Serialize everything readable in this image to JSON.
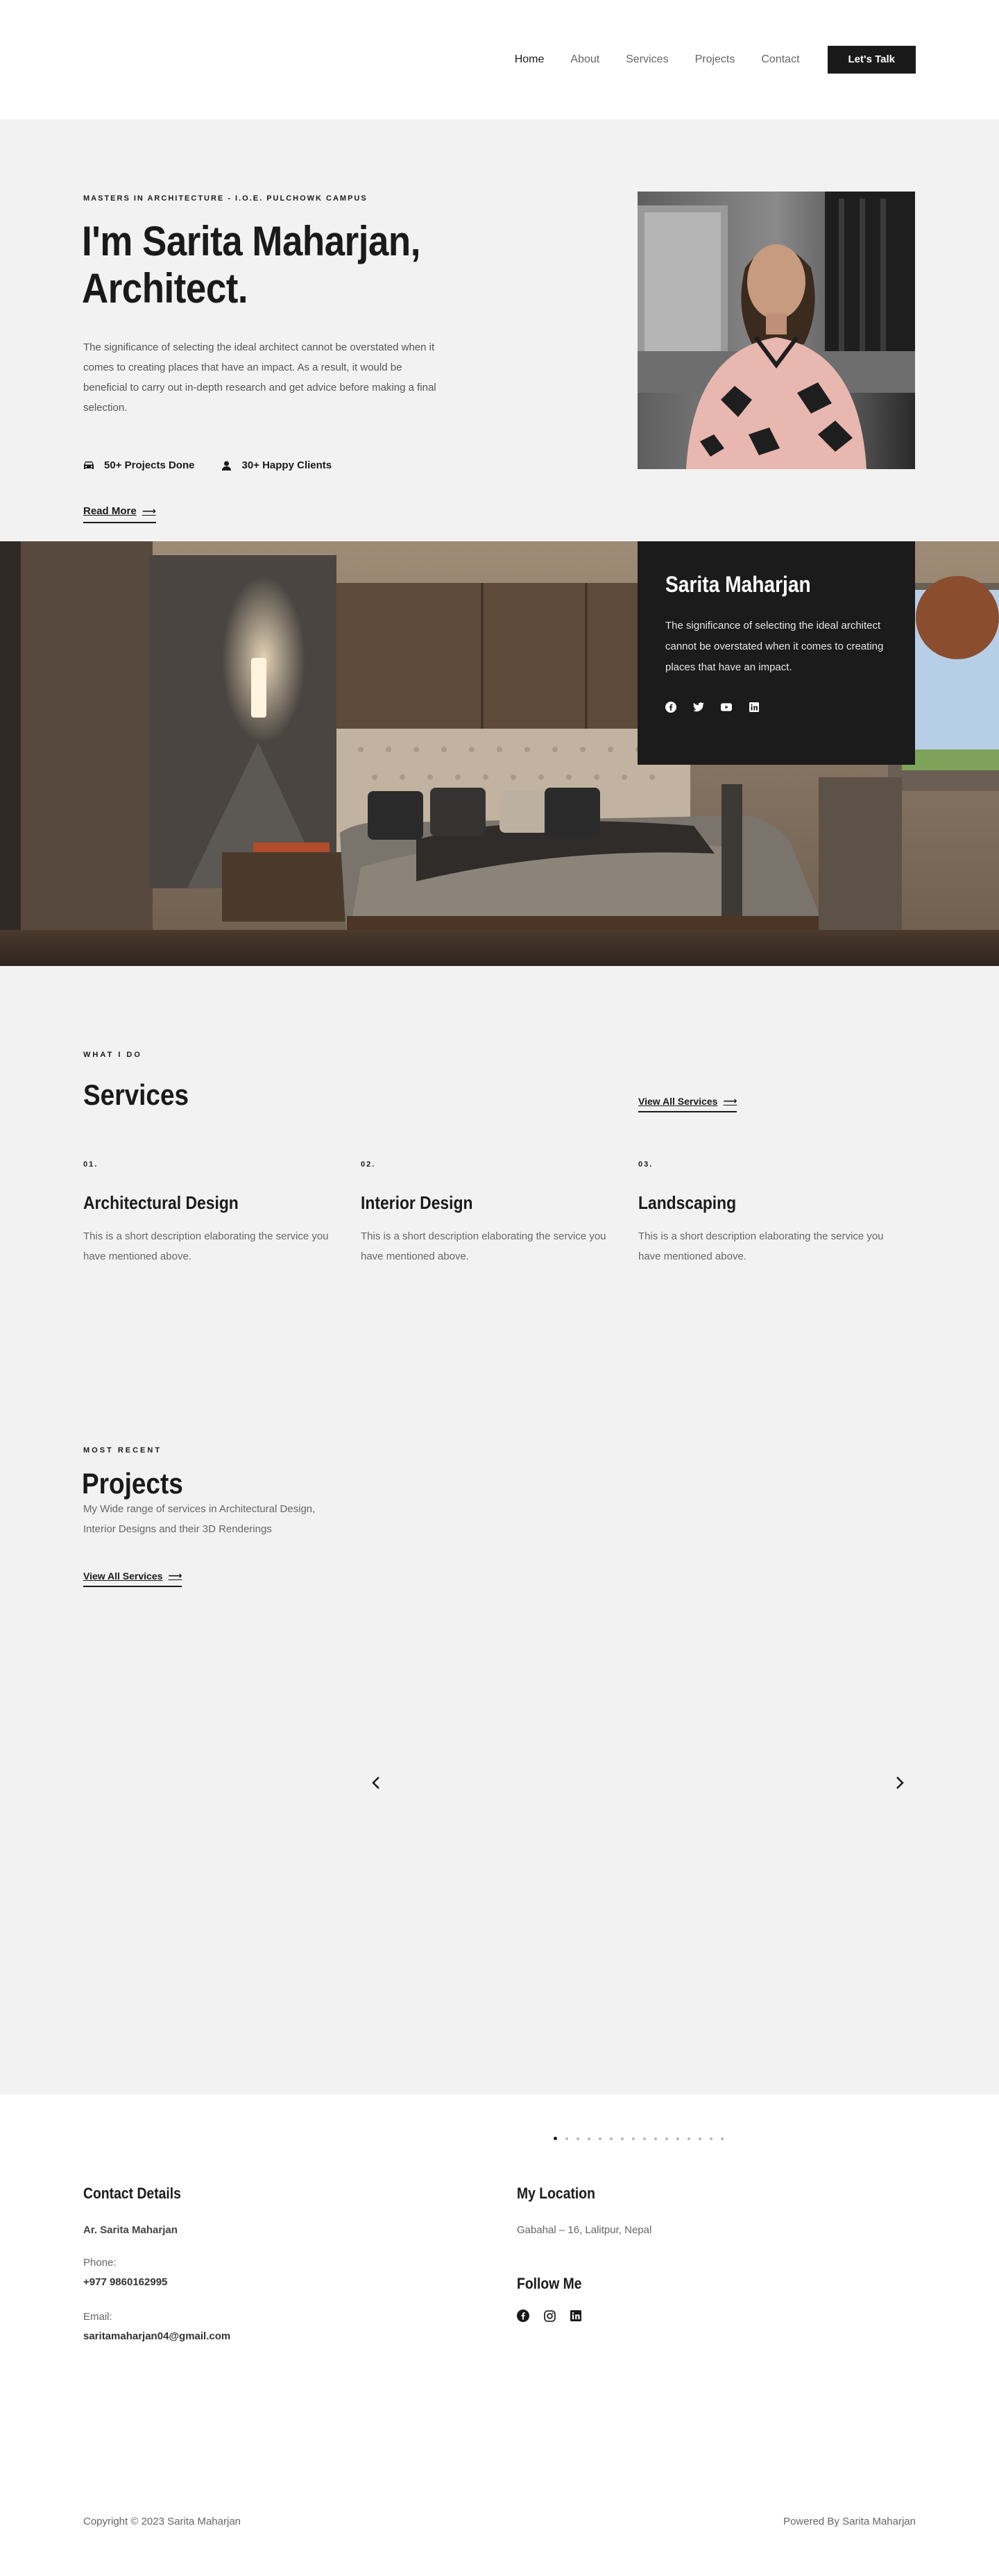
{
  "nav": {
    "items": [
      {
        "label": "Home"
      },
      {
        "label": "About"
      },
      {
        "label": "Services"
      },
      {
        "label": "Projects"
      },
      {
        "label": "Contact"
      }
    ],
    "cta_label": "Let's Talk"
  },
  "hero": {
    "eyebrow": "MASTERS IN ARCHITECTURE - I.O.E. PULCHOWK CAMPUS",
    "title_line1": "I'm Sarita Maharjan,",
    "title_line2": "Architect.",
    "description": "The significance of selecting the ideal architect cannot be overstated when it comes to creating places that have an impact. As a result, it would be beneficial to carry out in-depth research and get advice before making a final selection.",
    "stats": [
      {
        "label": "50+ Projects Done",
        "icon": "car-icon"
      },
      {
        "label": "30+ Happy Clients",
        "icon": "user-icon"
      }
    ],
    "read_more": "Read More"
  },
  "bio": {
    "name": "Sarita Maharjan",
    "text": "The significance of selecting the ideal architect cannot be overstated when it comes to creating places that have an impact.",
    "socials": [
      "facebook-icon",
      "twitter-icon",
      "youtube-icon",
      "linkedin-icon"
    ]
  },
  "services": {
    "eyebrow": "WHAT I DO",
    "title": "Services",
    "view_all": "View All Services",
    "items": [
      {
        "num": "01.",
        "title": "Architectural Design",
        "desc": "This is a short description elaborating the service you have mentioned above."
      },
      {
        "num": "02.",
        "title": "Interior Design",
        "desc": "This is a short description elaborating the service you have mentioned above."
      },
      {
        "num": "03.",
        "title": "Landscaping",
        "desc": "This is a short description elaborating the service you have mentioned above."
      }
    ]
  },
  "projects": {
    "eyebrow": "MOST RECENT",
    "title": "Projects",
    "desc": "My Wide range of services in Architectural Design, Interior Designs and their 3D Renderings",
    "view_all": "View All Services"
  },
  "carousel": {
    "dot_count": 16,
    "active_index": 0
  },
  "contact": {
    "details_title": "Contact Details",
    "name": "Ar. Sarita Maharjan",
    "phone_label": "Phone:",
    "phone": "+977 9860162995",
    "email_label": "Email:",
    "email": "saritamaharjan04@gmail.com",
    "location_title": "My Location",
    "address": "Gabahal – 16, Lalitpur, Nepal",
    "follow_title": "Follow Me",
    "follow_icons": [
      "facebook-icon",
      "instagram-icon",
      "linkedin-icon"
    ]
  },
  "footer": {
    "copyright": "Copyright © 2023 Sarita Maharjan",
    "powered": "Powered By Sarita Maharjan"
  },
  "colors": {
    "dark": "#1a1a1a",
    "light_bg": "#f2f2f2",
    "muted_text": "#666666"
  }
}
